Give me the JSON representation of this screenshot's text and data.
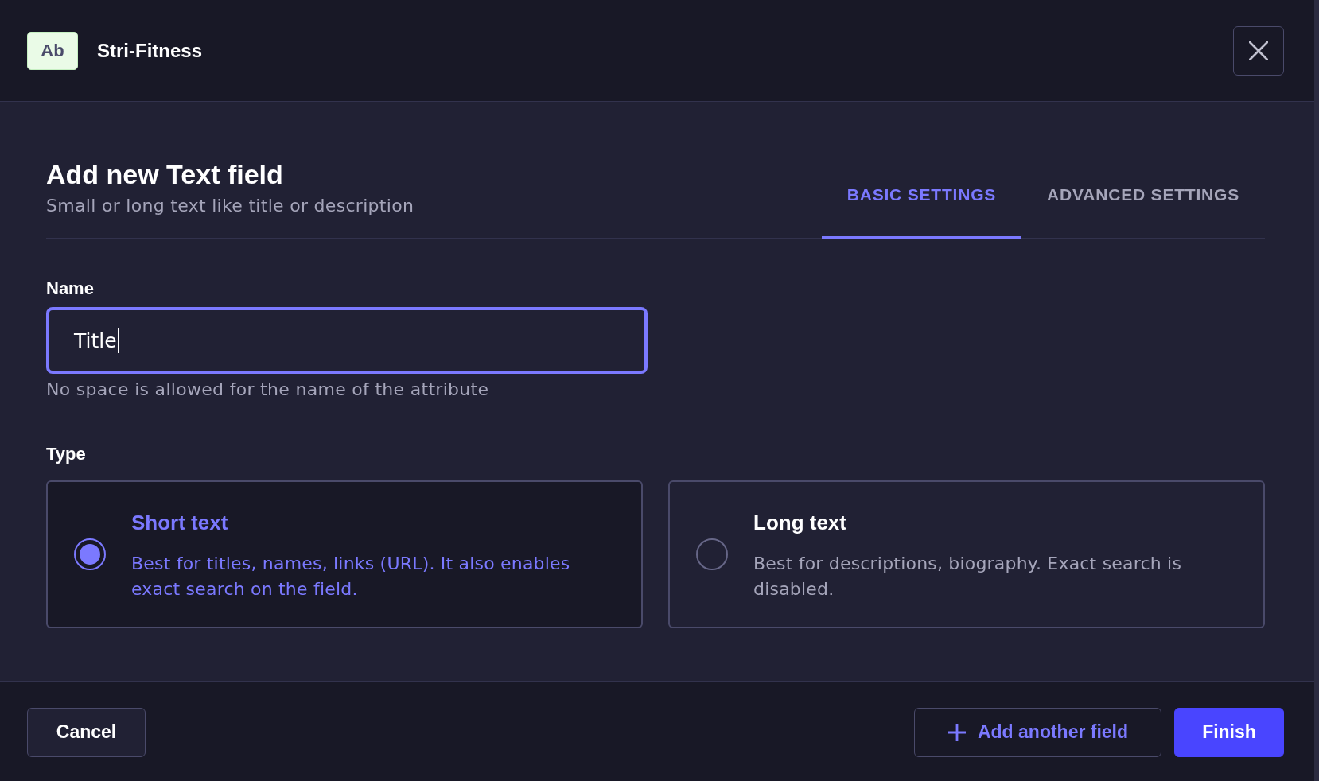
{
  "header": {
    "badge": "Ab",
    "title": "Stri-Fitness"
  },
  "form": {
    "title": "Add new Text field",
    "subtitle": "Small or long text like title or description",
    "tabs": [
      {
        "label": "BASIC SETTINGS",
        "selected": true
      },
      {
        "label": "ADVANCED SETTINGS",
        "selected": false
      }
    ]
  },
  "name_field": {
    "label": "Name",
    "value": "Title",
    "focused": true,
    "hint": "No space is allowed for the name of the attribute"
  },
  "type": {
    "label": "Type",
    "options": [
      {
        "title": "Short text",
        "description": "Best for titles, names, links (URL). It also enables exact search on the field.",
        "selected": true
      },
      {
        "title": "Long text",
        "description": "Best for descriptions, biography. Exact search is disabled.",
        "selected": false
      }
    ]
  },
  "footer": {
    "cancel": "Cancel",
    "add_another": "Add another field",
    "finish": "Finish"
  }
}
